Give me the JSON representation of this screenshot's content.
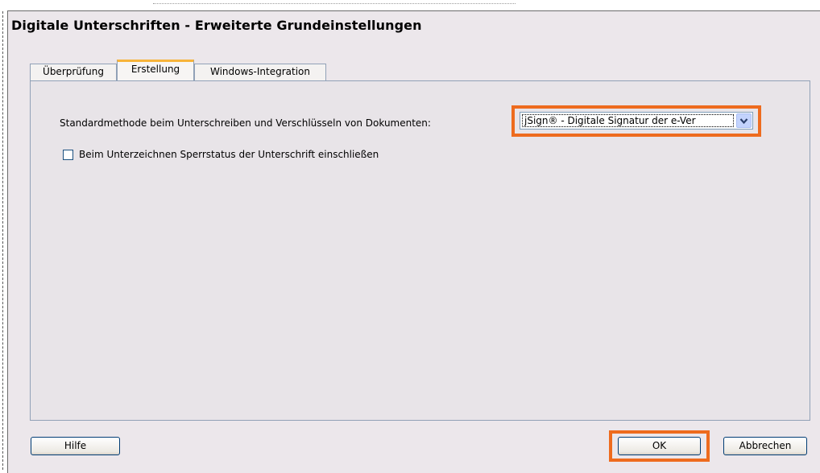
{
  "window": {
    "title": "Digitale Unterschriften - Erweiterte Grundeinstellungen"
  },
  "tabs": [
    {
      "label": "Überprüfung",
      "active": false
    },
    {
      "label": "Erstellung",
      "active": true
    },
    {
      "label": "Windows-Integration",
      "active": false
    }
  ],
  "erstellung": {
    "method_label": "Standardmethode beim Unterschreiben und Verschlüsseln von Dokumenten:",
    "method_selected": "jSign® - Digitale Signatur der e-Ver",
    "checkbox_label": "Beim Unterzeichnen Sperrstatus der Unterschrift einschließen",
    "checkbox_checked": false
  },
  "buttons": {
    "help": "Hilfe",
    "ok": "OK",
    "cancel": "Abbrechen"
  },
  "colors": {
    "highlight": "#ee6b1e",
    "active_tab_accent": "#f7b43a",
    "dialog_bg": "#ece7eb"
  },
  "icons": {
    "dropdown": "chevron-down-icon"
  }
}
